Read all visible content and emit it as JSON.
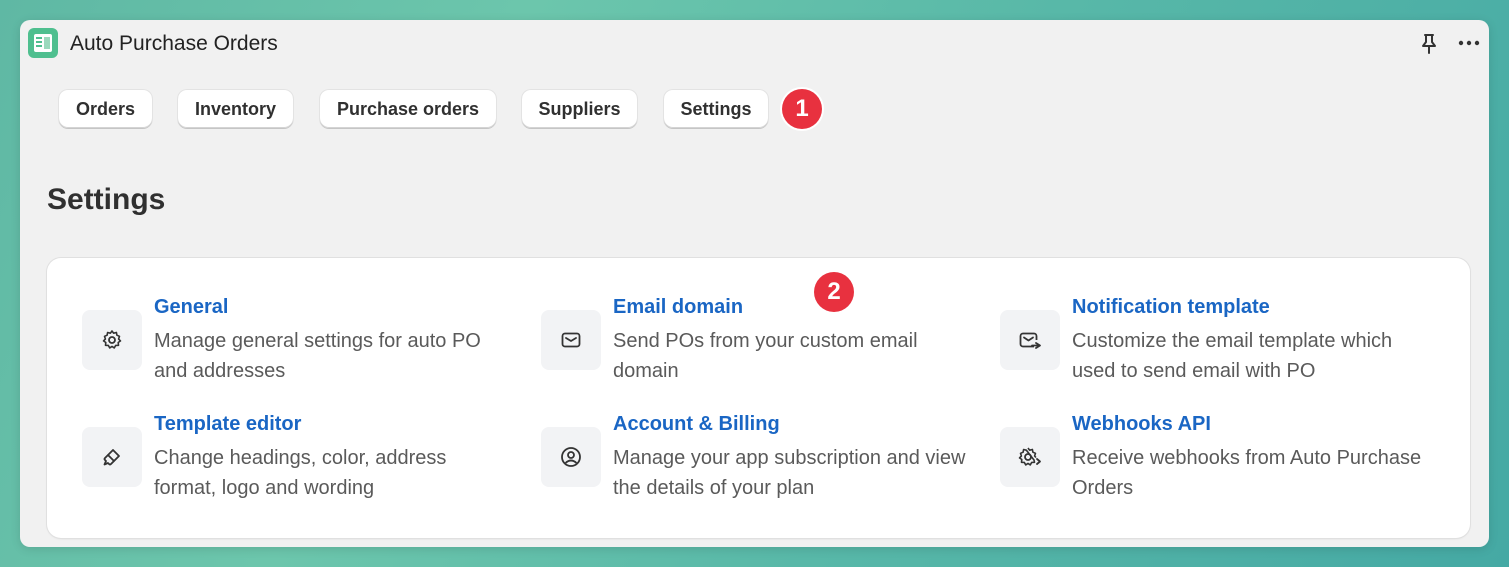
{
  "window": {
    "title": "Auto Purchase Orders"
  },
  "tabs": [
    {
      "label": "Orders"
    },
    {
      "label": "Inventory"
    },
    {
      "label": "Purchase orders"
    },
    {
      "label": "Suppliers"
    },
    {
      "label": "Settings"
    }
  ],
  "annotations": {
    "badge1": "1",
    "badge2": "2",
    "color": "#e8313f"
  },
  "page": {
    "title": "Settings"
  },
  "settings": [
    {
      "title": "General",
      "desc": "Manage general settings for auto PO and addresses",
      "icon": "gear-icon"
    },
    {
      "title": "Email domain",
      "desc": "Send POs from your custom email domain",
      "icon": "envelope-icon"
    },
    {
      "title": "Notification template",
      "desc": "Customize the email template which used to send email with PO",
      "icon": "email-forward-icon"
    },
    {
      "title": "Template editor",
      "desc": "Change headings, color, address format, logo and wording",
      "icon": "paintbrush-icon"
    },
    {
      "title": "Account & Billing",
      "desc": "Manage your app subscription and view the details of your plan",
      "icon": "user-circle-icon"
    },
    {
      "title": "Webhooks API",
      "desc": "Receive webhooks from Auto Purchase Orders",
      "icon": "gear-arrow-icon"
    }
  ],
  "colors": {
    "link": "#1a66c4",
    "app_icon": "#4fbf8f"
  }
}
